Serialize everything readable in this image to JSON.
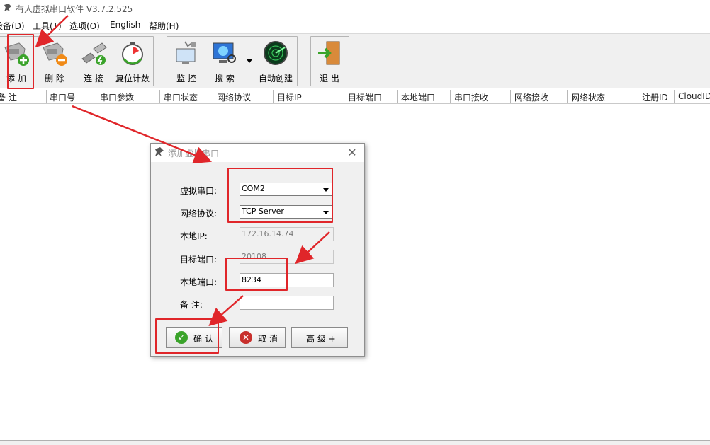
{
  "window": {
    "title": "有人虚拟串口软件 V3.7.2.525"
  },
  "menu": [
    {
      "label": "设备(D)"
    },
    {
      "label": "工具(T)"
    },
    {
      "label": "选项(O)"
    },
    {
      "label": "English"
    },
    {
      "label": "帮助(H)"
    }
  ],
  "toolbar": {
    "add": "添 加",
    "delete": "删 除",
    "connect": "连 接",
    "reset_count": "复位计数",
    "monitor": "监 控",
    "search": "搜 索",
    "auto_create": "自动创建",
    "exit": "退 出"
  },
  "columns": [
    "备 注",
    "串口号",
    "串口参数",
    "串口状态",
    "网络协议",
    "目标IP",
    "目标端口",
    "本地端口",
    "串口接收",
    "网络接收",
    "网络状态",
    "注册ID",
    "CloudID"
  ],
  "dialog": {
    "title": "添加虚拟串口",
    "close": "✕",
    "fields": {
      "virtual_port_label": "虚拟串口:",
      "virtual_port_value": "COM2",
      "protocol_label": "网络协议:",
      "protocol_value": "TCP Server",
      "local_ip_label": "本地IP:",
      "local_ip_value": "172.16.14.74",
      "target_port_label": "目标端口:",
      "target_port_value": "20108",
      "local_port_label": "本地端口:",
      "local_port_value": "8234",
      "remark_label": "备  注:",
      "remark_value": ""
    },
    "buttons": {
      "ok": "确 认",
      "cancel": "取 消",
      "advanced": "高 级 +"
    }
  },
  "colors": {
    "annotation_red": "#e0262a",
    "ok_green": "#3aa32a",
    "cancel_red": "#c8302c"
  }
}
